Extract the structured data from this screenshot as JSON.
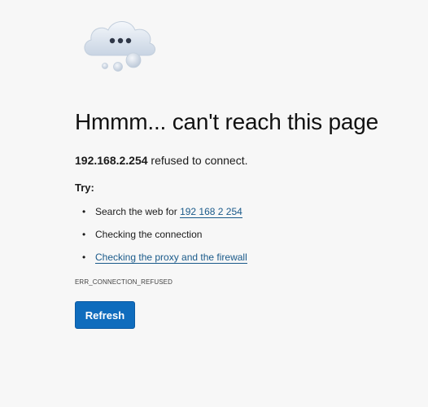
{
  "illustration": {
    "name": "cloud-thinking-icon",
    "cloud_color": "#d8e1ec",
    "dots_color": "#2f3747"
  },
  "error": {
    "headline": "Hmmm... can't reach this page",
    "host": "192.168.2.254",
    "host_suffix": " refused to connect.",
    "try_label": "Try:",
    "suggestions": [
      {
        "prefix": "Search the web for ",
        "link": "192 168 2 254"
      },
      {
        "text": "Checking the connection"
      },
      {
        "link": "Checking the proxy and the firewall"
      }
    ],
    "code": "ERR_CONNECTION_REFUSED"
  },
  "actions": {
    "refresh_label": "Refresh"
  },
  "colors": {
    "background": "#f7f7f7",
    "primary_button": "#0f6cbd",
    "link": "#1a5a8a"
  }
}
